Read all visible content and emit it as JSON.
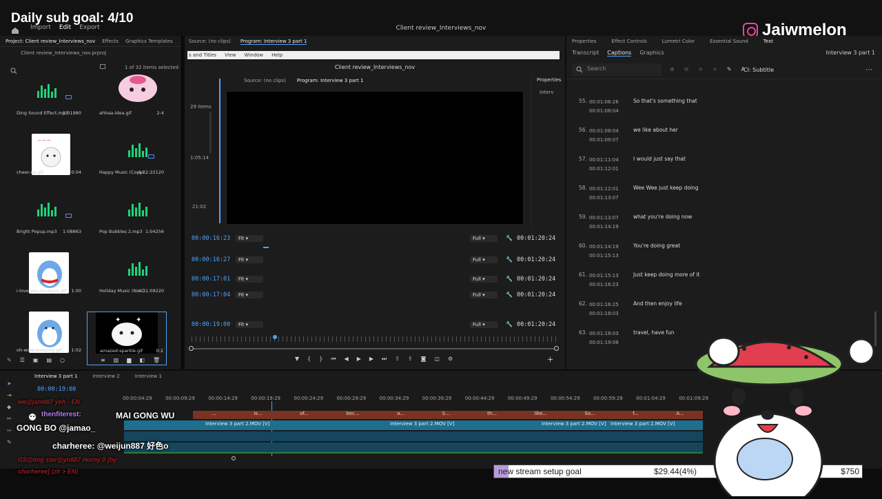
{
  "overlay": {
    "goal_text": "Daily sub goal: 4/10",
    "brand_name": "Jaiwmelon",
    "stream_goal": {
      "label": "new stream setup goal",
      "amount": "$29.44(4%)",
      "target": "$750",
      "progress": 0.04
    }
  },
  "app": {
    "menu": [
      "Import",
      "Edit",
      "Export"
    ],
    "window_title": "Client review_Interviews_nov",
    "sub_window_title": "Client review_Interviews_nov",
    "left_tabs": [
      "Project: Client review_Interviews_nov",
      "Effects",
      "Graphics Templates"
    ],
    "center_tabs": [
      "Source: (no clips)",
      "Program: Interview 3 part 1"
    ],
    "menubar2": [
      "s and Titles",
      "View",
      "Window",
      "Help"
    ],
    "right_tabs": [
      "Properties",
      "Effect Controls",
      "Lumetri Color",
      "Essential Sound",
      "Text"
    ],
    "right_subtabs": [
      "Transcript",
      "Captions",
      "Graphics"
    ],
    "right_sequence": "Interview 3 part 1"
  },
  "project": {
    "file": "Client review_Interviews_nov.prproj",
    "count": "1 of 32 items selected",
    "items": [
      {
        "name": "Ding Sound Effect.mp3",
        "dur": "1:01980",
        "type": "audio"
      },
      {
        "name": "ahhaa-idea.gif",
        "dur": "2:4",
        "type": "image"
      },
      {
        "name": "cheer-up.gif",
        "dur": "0:04",
        "type": "image"
      },
      {
        "name": "Happy Music (Copyr...",
        "dur": "4:22:22120",
        "type": "audio"
      },
      {
        "name": "Bright Popup.mp3",
        "dur": "1:08863",
        "type": "audio"
      },
      {
        "name": "Pop Bubbles 2.mp3",
        "dur": "1:04256",
        "type": "audio"
      },
      {
        "name": "i-love-you-iloveyou.gif",
        "dur": "1:00",
        "type": "image"
      },
      {
        "name": "Holiday Music (No C...",
        "dur": "4:31:09220",
        "type": "audio"
      },
      {
        "name": "oh-wow-amazing.gif",
        "dur": "1:02",
        "type": "image"
      },
      {
        "name": "amazed-sparkle.gif",
        "dur": "0:2",
        "type": "image"
      }
    ]
  },
  "program": {
    "inner_tabs": [
      "Source: (no clips)",
      "Program: Interview 3 part 1"
    ],
    "side_labels": [
      "29 items",
      "1:05:14",
      "21:02"
    ],
    "properties_label": "Properties",
    "properties_item": "Interv",
    "rows": [
      {
        "tc": "00:00:16:23",
        "fit": "Fit",
        "full": "Full",
        "dur": "00:01:20:24"
      },
      {
        "tc": "00:00:16:27",
        "fit": "Fit",
        "full": "Full",
        "dur": "00:01:20:24"
      },
      {
        "tc": "00:00:17:01",
        "fit": "Fit",
        "full": "Full",
        "dur": "00:01:20:24"
      },
      {
        "tc": "00:00:17:04",
        "fit": "Fit",
        "full": "Full",
        "dur": "00:01:20:24"
      },
      {
        "tc": "00:00:19:00",
        "fit": "Fit",
        "full": "Full",
        "dur": "00:01:20:24"
      }
    ]
  },
  "captions": {
    "search_placeholder": "Search",
    "track_label": "CI: Subtitle",
    "rows": [
      {
        "idx": "55.",
        "start": "00:01:06:26",
        "end": "00:01:08:04",
        "text": "So that's something that"
      },
      {
        "idx": "56.",
        "start": "00:01:08:04",
        "end": "00:01:09:07",
        "text": "we like about her"
      },
      {
        "idx": "57.",
        "start": "00:01:11:04",
        "end": "00:01:12:01",
        "text": "I would just say that"
      },
      {
        "idx": "58.",
        "start": "00:01:12:01",
        "end": "00:01:13:07",
        "text": "Wee Wee just keep doing"
      },
      {
        "idx": "59.",
        "start": "00:01:13:07",
        "end": "00:01:14:19",
        "text": "what you're doing now"
      },
      {
        "idx": "60.",
        "start": "00:01:14:19",
        "end": "00:01:15:13",
        "text": "You're doing great"
      },
      {
        "idx": "61.",
        "start": "00:01:15:13",
        "end": "00:01:16:23",
        "text": "Just keep doing more of it"
      },
      {
        "idx": "62.",
        "start": "00:01:16:25",
        "end": "00:01:18:03",
        "text": "And then enjoy life"
      },
      {
        "idx": "63.",
        "start": "00:01:18:03",
        "end": "00:01:19:08",
        "text": "travel, have fun"
      }
    ]
  },
  "timeline": {
    "tabs": [
      "Interview 3 part 1",
      "Interview 2",
      "Interview 1"
    ],
    "playhead": "00:00:19:00",
    "ruler": [
      "00:00:04:29",
      "00:00:09:29",
      "00:00:14:29",
      "00:00:19:29",
      "00:00:24:29",
      "00:00:29:29",
      "00:00:34:29",
      "00:00:39:29",
      "00:00:44:29",
      "00:00:49:29",
      "00:00:54:29",
      "00:00:59:29",
      "00:01:04:29",
      "00:01:09:29"
    ],
    "clip_labels": [
      "Interview 3 part 2.MOV [V]",
      "Interview 3 part 2.MOV [V]",
      "Interview 3 part 2.MOV [V]",
      "Interview 3 part 2.MOV [V]"
    ],
    "subtitle_words": [
      "...",
      "is...",
      "of...",
      "bec...",
      "a...",
      "S...",
      "th...",
      "like...",
      "So...",
      "f...",
      "A..."
    ]
  },
  "credits": {
    "line1": "MAI GONG WU",
    "line1_prefix": "thenfiterest:",
    "line2": "GONG BO @jamao_",
    "line3": "charheree: @weijun887 好色o",
    "faded1": "we@jam887 yeh - EN",
    "faded2": "GS@ling ster@yn887 Horny 0 (by",
    "faded3": "charheree] (zh > EN)"
  },
  "colors": {
    "accent": "#4da3ff",
    "audio_green": "#1fd37a",
    "goal_fill": "#b89bdc",
    "timeline_clip": "#1e6f8f",
    "subtitle_clip": "#8a3a2a"
  }
}
